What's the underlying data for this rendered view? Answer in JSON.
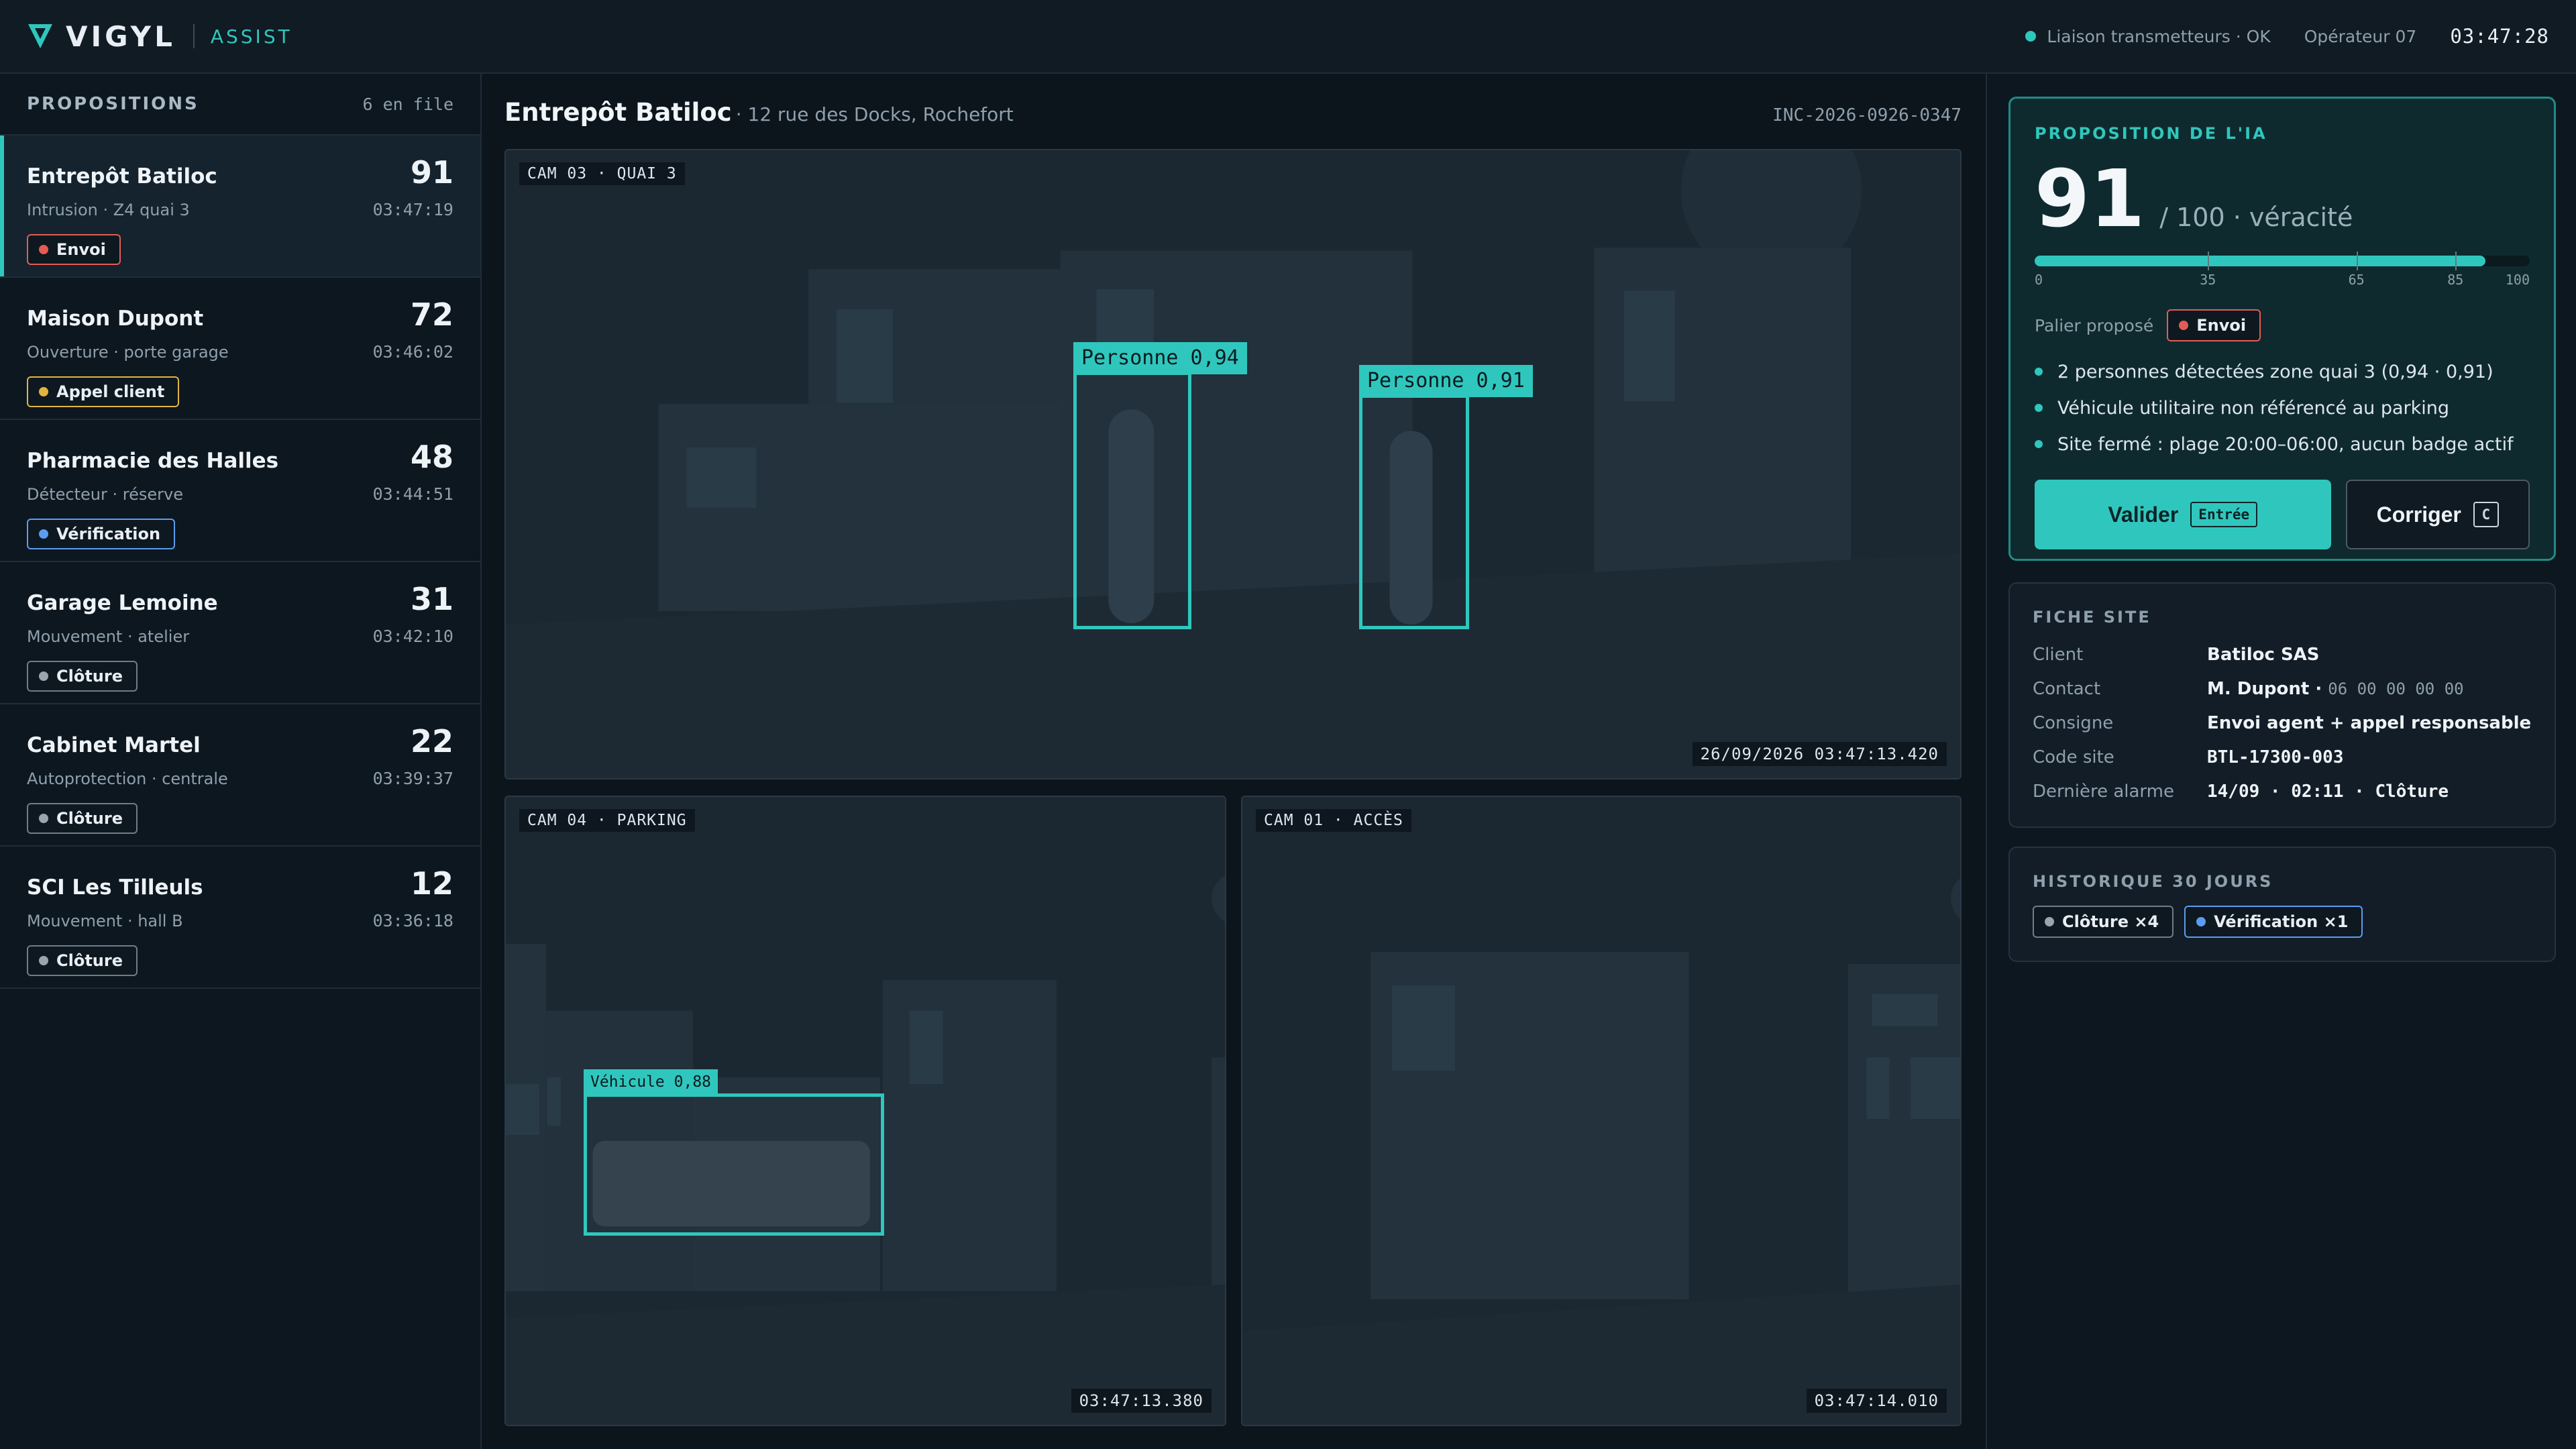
{
  "topbar": {
    "brand": "VIGYL",
    "brand_sub": "ASSIST",
    "status": "Liaison transmetteurs · OK",
    "operator": "Opérateur 07",
    "clock": "03:47:28"
  },
  "queue": {
    "title": "PROPOSITIONS",
    "count": "6 en file",
    "items": [
      {
        "name": "Entrepôt Batiloc",
        "score": "91",
        "desc": "Intrusion · Z4 quai 3",
        "time": "03:47:19",
        "badge": "Envoi",
        "badge_color": "#e25c55",
        "active": true
      },
      {
        "name": "Maison Dupont",
        "score": "72",
        "desc": "Ouverture · porte garage",
        "time": "03:46:02",
        "badge": "Appel client",
        "badge_color": "#e3b341"
      },
      {
        "name": "Pharmacie des Halles",
        "score": "48",
        "desc": "Détecteur · réserve",
        "time": "03:44:51",
        "badge": "Vérification",
        "badge_color": "#5b9cf0"
      },
      {
        "name": "Garage Lemoine",
        "score": "31",
        "desc": "Mouvement · atelier",
        "time": "03:42:10",
        "badge": "Clôture",
        "badge_color": "#9aa6ae"
      },
      {
        "name": "Cabinet Martel",
        "score": "22",
        "desc": "Autoprotection · centrale",
        "time": "03:39:37",
        "badge": "Clôture",
        "badge_color": "#9aa6ae"
      },
      {
        "name": "SCI Les Tilleuls",
        "score": "12",
        "desc": "Mouvement · hall B",
        "time": "03:36:18",
        "badge": "Clôture",
        "badge_color": "#9aa6ae"
      }
    ]
  },
  "incident": {
    "site": "Entrepôt Batiloc",
    "address": "· 12 rue des Docks, Rochefort",
    "id": "INC-2026-0926-0347"
  },
  "cameras": {
    "main": {
      "label": "CAM 03 · QUAI 3",
      "timestamp": "26/09/2026 03:47:13.420",
      "detections": [
        "Personne 0,94",
        "Personne 0,91"
      ]
    },
    "left": {
      "label": "CAM 04 · PARKING",
      "timestamp": "03:47:13.380",
      "detections": [
        "Véhicule 0,88"
      ]
    },
    "right": {
      "label": "CAM 01 · ACCÈS",
      "timestamp": "03:47:14.010"
    }
  },
  "ai": {
    "title": "PROPOSITION DE L'IA",
    "score": "91",
    "score_suffix": "/ 100 · véracité",
    "gauge_value": 91,
    "gauge_ticks": [
      35,
      65,
      85
    ],
    "gauge_labels": [
      "0",
      "35",
      "65",
      "85",
      "100"
    ],
    "palier_label": "Palier proposé",
    "palier": "Envoi",
    "palier_color": "#e25c55",
    "reasons": [
      "2 personnes détectées zone quai 3 (0,94 · 0,91)",
      "Véhicule utilitaire non référencé au parking",
      "Site fermé : plage 20:00–06:00, aucun badge actif"
    ],
    "validate_label": "Valider",
    "validate_key": "Entrée",
    "correct_label": "Corriger",
    "correct_key": "C"
  },
  "site_sheet": {
    "title": "FICHE SITE",
    "rows": [
      {
        "k": "Client",
        "v": "Batiloc SAS"
      },
      {
        "k": "Contact",
        "v": "M. Dupont ·",
        "extra": "06 00 00 00 00"
      },
      {
        "k": "Consigne",
        "v": "Envoi agent + appel responsable"
      },
      {
        "k": "Code site",
        "v": "BTL-17300-003"
      },
      {
        "k": "Dernière alarme",
        "v": "14/09 · 02:11 · Clôture"
      }
    ]
  },
  "history": {
    "title": "HISTORIQUE 30 JOURS",
    "badges": [
      {
        "label": "Clôture ×4",
        "color": "#9aa6ae",
        "border": "#6e7d88"
      },
      {
        "label": "Vérification ×1",
        "color": "#5b9cf0",
        "border": "#5b9cf0"
      }
    ]
  },
  "colors": {
    "accent": "#2fc7bd",
    "alert": "#e25c55",
    "warn": "#e3b341",
    "info": "#5b9cf0"
  }
}
